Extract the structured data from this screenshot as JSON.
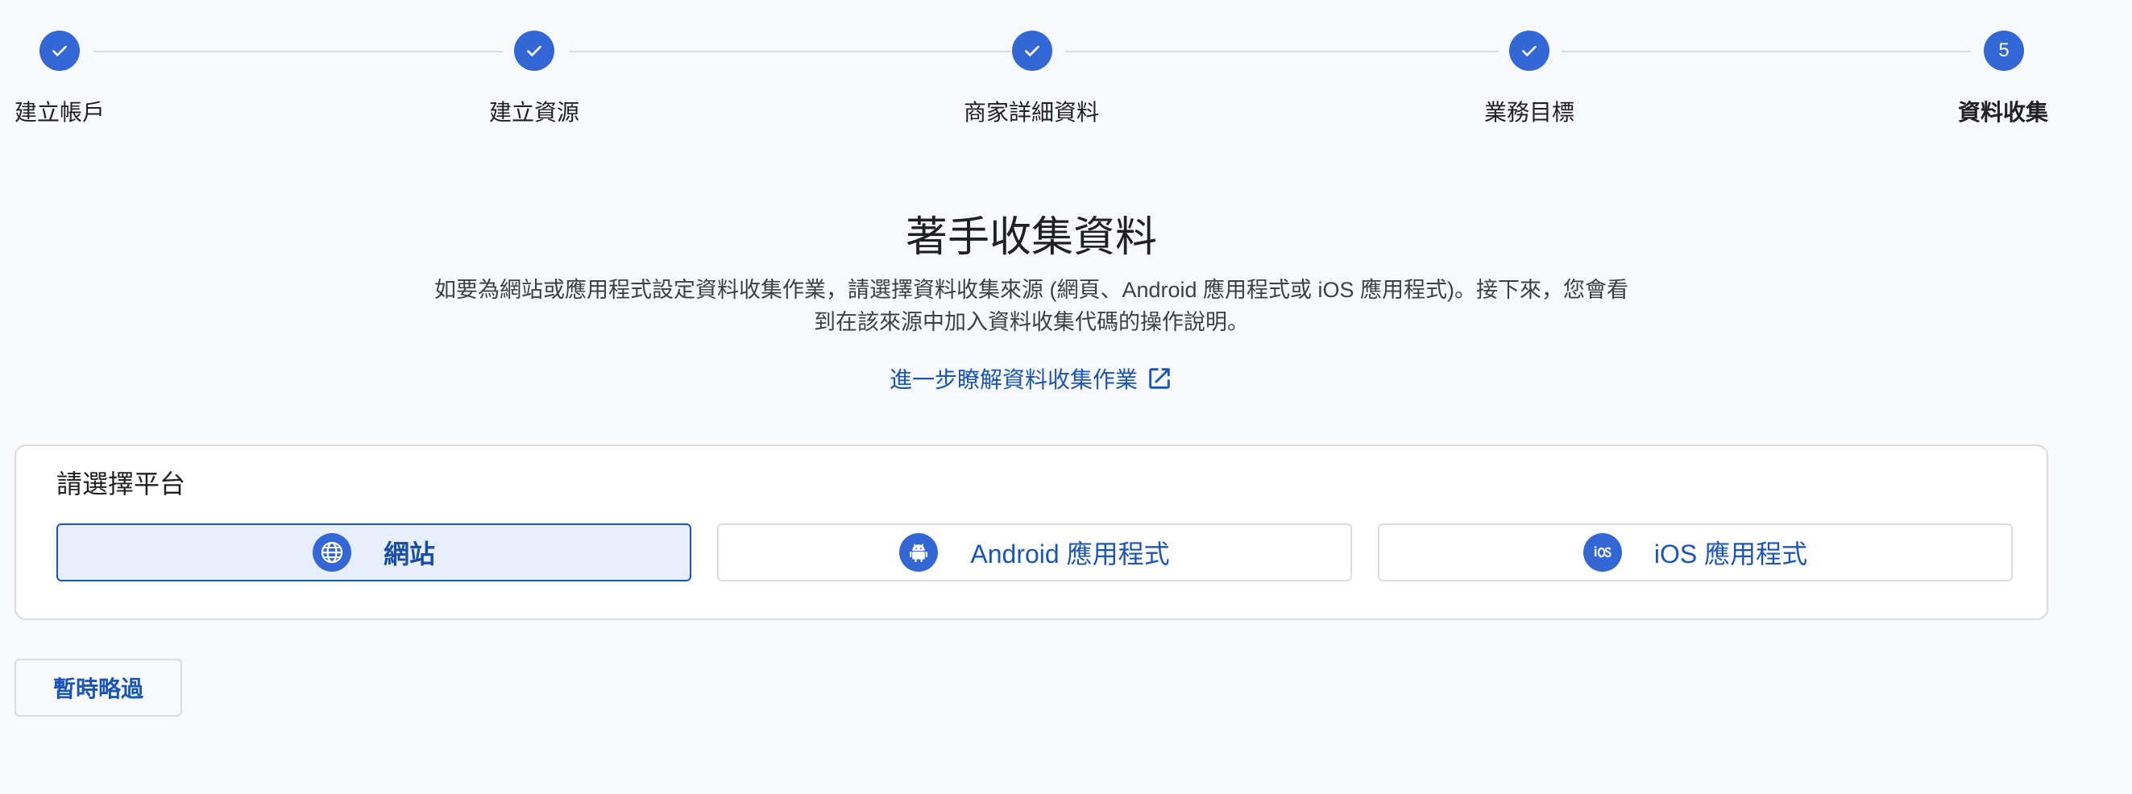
{
  "stepper": {
    "steps": [
      {
        "label": "建立帳戶",
        "state": "complete",
        "icon": "check-icon"
      },
      {
        "label": "建立資源",
        "state": "complete",
        "icon": "check-icon"
      },
      {
        "label": "商家詳細資料",
        "state": "complete",
        "icon": "check-icon"
      },
      {
        "label": "業務目標",
        "state": "complete",
        "icon": "check-icon"
      },
      {
        "label": "資料收集",
        "state": "current",
        "number": "5"
      }
    ]
  },
  "main": {
    "title": "著手收集資料",
    "description_line1": "如要為網站或應用程式設定資料收集作業，請選擇資料收集來源 (網頁、Android 應用程式或 iOS 應用程式)。接下來，您會看",
    "description_line2": "到在該來源中加入資料收集代碼的操作說明。",
    "learn_more": "進一步瞭解資料收集作業",
    "learn_more_icon": "external-link-icon"
  },
  "platform_card": {
    "title": "請選擇平台",
    "options": [
      {
        "label": "網站",
        "icon": "globe-icon",
        "selected": true
      },
      {
        "label": "Android 應用程式",
        "icon": "android-icon",
        "selected": false
      },
      {
        "label": "iOS 應用程式",
        "icon": "ios-icon",
        "selected": false
      }
    ]
  },
  "footer": {
    "skip_label": "暫時略過"
  },
  "colors": {
    "accent": "#3367d6",
    "link": "#1a56b8",
    "selected_bg": "#e8effb",
    "background": "#f8f9fb"
  }
}
